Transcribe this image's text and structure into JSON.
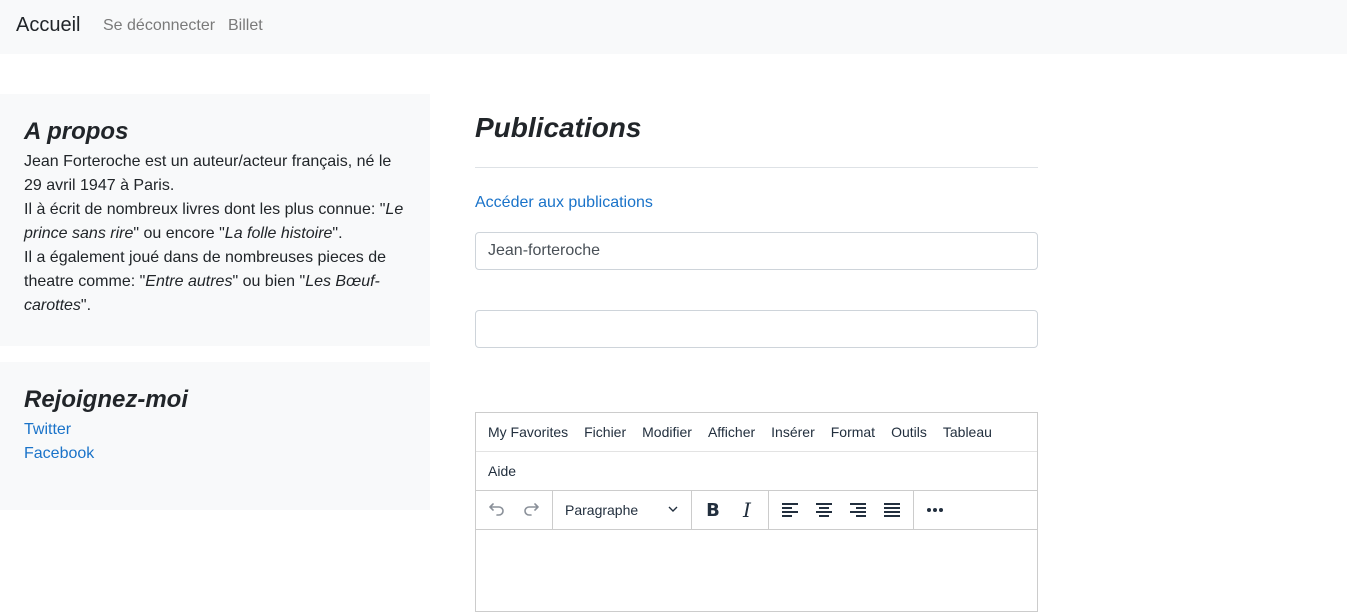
{
  "nav": {
    "brand": "Accueil",
    "links": [
      "Se déconnecter",
      "Billet"
    ]
  },
  "about": {
    "title": "A propos",
    "line1": "Jean Forteroche est un auteur/acteur français, né le 29 avril 1947 à Paris.",
    "line2_prefix": "Il à écrit de nombreux livres dont les plus connue: \"",
    "book1": "Le prince sans rire",
    "line2_mid": "\" ou encore \"",
    "book2": "La folle histoire",
    "line2_suffix": "\".",
    "line3_prefix": "Il a également joué dans de nombreuses pieces de theatre comme: \"",
    "play1": "Entre autres",
    "line3_mid": "\" ou bien \"",
    "play2": "Les Bœuf-carottes",
    "line3_suffix": "\"."
  },
  "join": {
    "title": "Rejoignez-moi",
    "links": [
      "Twitter",
      "Facebook"
    ]
  },
  "main": {
    "title": "Publications",
    "access_link": "Accéder aux publications",
    "author_value": "Jean-forteroche",
    "title_value": ""
  },
  "editor": {
    "menu": [
      "My Favorites",
      "Fichier",
      "Modifier",
      "Afficher",
      "Insérer",
      "Format",
      "Outils",
      "Tableau"
    ],
    "menu_row2": [
      "Aide"
    ],
    "block_format": "Paragraphe"
  },
  "colors": {
    "link": "#1a73c9",
    "navbar_bg": "#f8f9fa",
    "panel_bg": "#f8f9fa"
  }
}
